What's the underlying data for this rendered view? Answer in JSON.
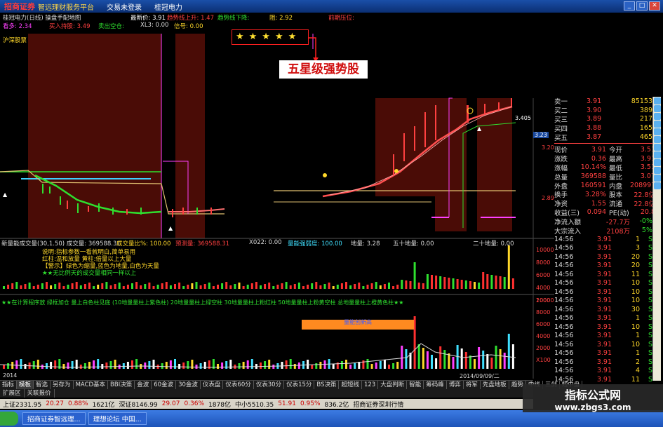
{
  "titlebar": {
    "brand": "招商证券",
    "subtitle": "智远理财服务平台",
    "menu1": "交易未登录",
    "menu2": "桂冠电力"
  },
  "header": {
    "stock": "桂冠电力(日线) 操盘手配地图",
    "newprice_lbl": "最新价: 3.91",
    "trend1": "趋势线上升: 1.47",
    "trend2": "趋势线下降:",
    "resist": "阻: 2.92",
    "bullline": "前期压位:",
    "sig1": "看多: 2.34",
    "sig2": "买入持股: 3.49",
    "sig3": "卖出空仓:",
    "xl": "XL3: 0.00",
    "flag": "信号: 0.00",
    "chart_title": "沪深股票"
  },
  "annotation": {
    "stars": "★★★★★",
    "label": "五星级强势股"
  },
  "mid_header": {
    "a": "新量能成交量(30,1.50) 成交量: 369588.31",
    "b": "成交量比%: 100.00",
    "c": "预测量: 369588.31",
    "d": "X022: 0.00",
    "e": "量能强弱度: 100.00",
    "f": "地量: 3.28",
    "g": "五十地量: 0.00",
    "h": "二十地量: 0.00"
  },
  "vol_text": {
    "l1": "说明:指标参数一看就明白,简单易用",
    "l2": "红柱:温和放量 黄柱:倍量以上大量",
    "l3": "【警示】绿色为缩量,蓝色为地量,白色为天量",
    "l4": "★★无比例天的成交量相同一样以上"
  },
  "lower_header": "★★在计算程序放 绿框加仓 量上白色柱见底 (10地量量柱上紫色柱) 20地量量柱上绿空柱 30地量量柱上粉红柱 50地量量柱上粉黄空柱 总地量量柱上橙黄色柱★★",
  "lower_box": "量能创新高",
  "date_label": "2014/09/09/二",
  "year_label": "2014",
  "vol_axis": [
    "10000",
    "8000",
    "6000",
    "4000",
    "2000"
  ],
  "lower_axis": [
    "10000",
    "8000",
    "6000",
    "4000",
    "2000",
    "X100"
  ],
  "price_axis": [
    "3.405",
    "3.23",
    "3.20",
    "2.89"
  ],
  "orderbook": [
    {
      "l": "卖一",
      "p": "3.91",
      "v": "85153"
    },
    {
      "l": "买二",
      "p": "3.90",
      "v": "389"
    },
    {
      "l": "买三",
      "p": "3.89",
      "v": "217"
    },
    {
      "l": "买四",
      "p": "3.88",
      "v": "165"
    },
    {
      "l": "买五",
      "p": "3.87",
      "v": "465"
    }
  ],
  "quotes": [
    {
      "a": "现价",
      "b": "3.91",
      "c": "今开",
      "d": "3.51"
    },
    {
      "a": "涨跌",
      "b": "0.36",
      "c": "最高",
      "d": "3.91"
    },
    {
      "a": "涨幅",
      "b": "10.14%",
      "c": "最低",
      "d": "3.51"
    },
    {
      "a": "总量",
      "b": "369588",
      "c": "量比",
      "d": "3.07"
    },
    {
      "a": "外盘",
      "b": "160591",
      "c": "内盘",
      "d": "208997"
    },
    {
      "a": "换手",
      "b": "3.28%",
      "c": "股本",
      "d": "22.8亿"
    },
    {
      "a": "净资",
      "b": "1.55",
      "c": "流通",
      "d": "22.8亿"
    },
    {
      "a": "收益(三)",
      "b": "0.094",
      "c": "PE(动)",
      "d": "20.8"
    }
  ],
  "flows": [
    {
      "a": "净流入额",
      "b": "-27.7万",
      "c": "-0%"
    },
    {
      "a": "大宗流入",
      "b": "2108万",
      "c": "5%"
    }
  ],
  "ticks": [
    {
      "t": "14:56",
      "p": "3.91",
      "v": "1",
      "s": "S"
    },
    {
      "t": "14:56",
      "p": "3.91",
      "v": "3",
      "s": "S"
    },
    {
      "t": "14:56",
      "p": "3.91",
      "v": "20",
      "s": "S"
    },
    {
      "t": "14:56",
      "p": "3.91",
      "v": "20",
      "s": "S"
    },
    {
      "t": "14:56",
      "p": "3.91",
      "v": "11",
      "s": "S"
    },
    {
      "t": "14:56",
      "p": "3.91",
      "v": "10",
      "s": "S"
    },
    {
      "t": "14:56",
      "p": "3.91",
      "v": "10",
      "s": "S"
    },
    {
      "t": "14:56",
      "p": "3.91",
      "v": "10",
      "s": "S"
    },
    {
      "t": "14:56",
      "p": "3.91",
      "v": "30",
      "s": "S"
    },
    {
      "t": "14:56",
      "p": "3.91",
      "v": "1",
      "s": "S"
    },
    {
      "t": "14:56",
      "p": "3.91",
      "v": "10",
      "s": "S"
    },
    {
      "t": "14:56",
      "p": "3.91",
      "v": "1",
      "s": "S"
    },
    {
      "t": "14:56",
      "p": "3.91",
      "v": "10",
      "s": "S"
    },
    {
      "t": "14:56",
      "p": "3.91",
      "v": "1",
      "s": "S"
    },
    {
      "t": "14:56",
      "p": "3.91",
      "v": "2",
      "s": "S"
    },
    {
      "t": "14:56",
      "p": "3.91",
      "v": "4",
      "s": "S"
    },
    {
      "t": "14:56",
      "p": "3.91",
      "v": "11",
      "s": "S"
    }
  ],
  "tabs": [
    "指标",
    "模板",
    "智选",
    "另存为",
    "MACD基本",
    "BBI决策",
    "金波",
    "60金波",
    "30金波",
    "仪表盘",
    "仪表60分",
    "仪表30分",
    "仪表15分",
    "BS决策",
    "超短线",
    "123",
    "大盘判断",
    "智能",
    "筹码峰",
    "博弈",
    "将军",
    "先盘地板",
    "趋势",
    "中线",
    "三剑",
    "短中盘"
  ],
  "tabs_active": "模板",
  "tabs2": [
    "扩展区",
    "关联报价"
  ],
  "statusbar": {
    "sh": "上证2331.95",
    "sh_chg": "20.27",
    "sh_pct": "0.88%",
    "sh_amt": "1621亿",
    "sz": "深证8146.99",
    "sz_chg": "29.07",
    "sz_pct": "0.36%",
    "sz_amt": "1878亿",
    "zx": "中小5510.35",
    "zx_chg": "51.91",
    "zx_pct": "0.95%",
    "zx_amt": "836.2亿",
    "broker": "招商证券深圳行情"
  },
  "taskbar": {
    "t1": "招商证券智远理...",
    "t2": "理想论坛 中国..."
  },
  "watermark": {
    "line1": "指标公式网",
    "line2": "www.zbgs3.com"
  },
  "right_labels": {
    "buy_sell": "买一",
    "pe": "PE(动)"
  },
  "colors": {
    "up": "#ff4040",
    "down": "#2fe02f",
    "accent": "#ffd82a"
  }
}
